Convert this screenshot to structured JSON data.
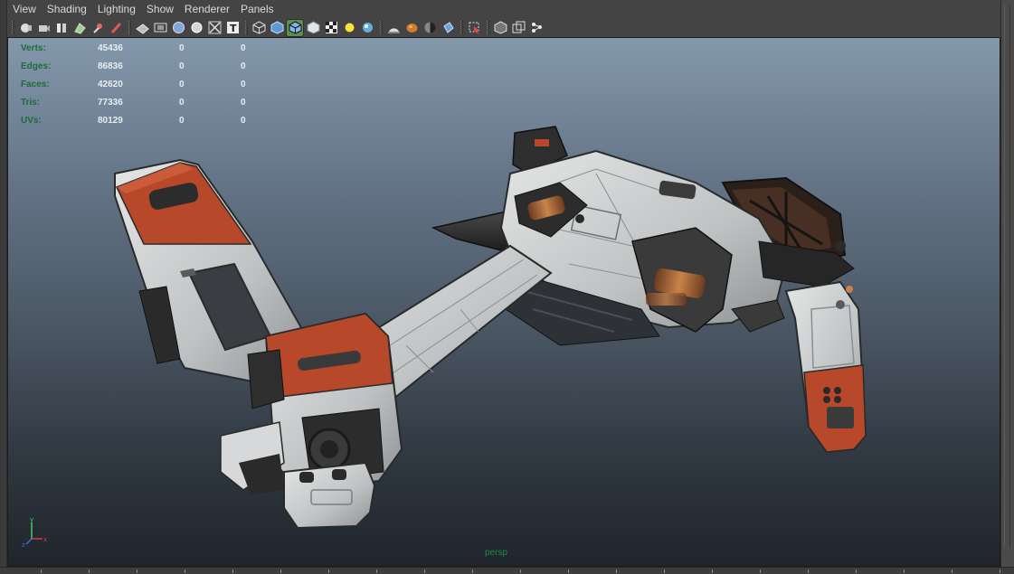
{
  "menu": [
    "View",
    "Shading",
    "Lighting",
    "Show",
    "Renderer",
    "Panels"
  ],
  "toolbar": {
    "groups": [
      [
        "camera-select-icon",
        "camera-attributes-icon",
        "bookmarks-icon",
        "image-plane-icon",
        "two-d-pan-zoom-icon",
        "grease-pencil-icon"
      ],
      [
        "grid-icon",
        "film-gate-icon",
        "resolution-gate-icon",
        "gate-mask-icon",
        "field-chart-icon",
        "safe-title-icon"
      ],
      [
        "wireframe-icon",
        "smooth-shade-icon",
        "wireframe-on-shaded-icon",
        "xray-icon",
        "textured-icon",
        "default-lighting-icon",
        "all-lights-icon"
      ],
      [
        "shadows-icon",
        "screen-space-ao-icon",
        "motion-blur-icon",
        "anti-aliasing-icon"
      ],
      [
        "isolate-select-icon"
      ],
      [
        "xray-joints-icon",
        "xray-active-icon",
        "backface-culling-icon"
      ]
    ],
    "active": "wireframe-on-shaded-icon"
  },
  "hud": {
    "rows": [
      {
        "label": "Verts:",
        "v1": "45436",
        "v2": "0",
        "v3": "0"
      },
      {
        "label": "Edges:",
        "v1": "86836",
        "v2": "0",
        "v3": "0"
      },
      {
        "label": "Faces:",
        "v1": "42620",
        "v2": "0",
        "v3": "0"
      },
      {
        "label": "Tris:",
        "v1": "77336",
        "v2": "0",
        "v3": "0"
      },
      {
        "label": "UVs:",
        "v1": "80129",
        "v2": "0",
        "v3": "0"
      }
    ]
  },
  "viewport": {
    "camera": "persp",
    "axis": {
      "x": "x",
      "y": "y",
      "z": "z"
    }
  },
  "colors": {
    "hud_label": "#1f6b3a",
    "camera_label": "#1d8a3e",
    "active_button": "#5c8f4f",
    "hull_white": "#cfd2d3",
    "hull_orange": "#b8482a"
  }
}
